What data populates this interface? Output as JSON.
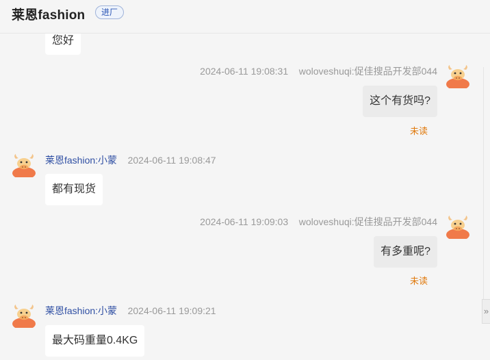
{
  "header": {
    "shop_name": "莱恩fashion",
    "tag": "进厂"
  },
  "messages": [
    {
      "text": "您好"
    },
    {
      "time": "2024-06-11 19:08:31",
      "sender": "woloveshuqi:促佳搜品开发部044",
      "text": "这个有货吗?",
      "status": "未读"
    },
    {
      "time": "2024-06-11 19:08:47",
      "sender": "莱恩fashion:小蒙",
      "text": "都有现货"
    },
    {
      "time": "2024-06-11 19:09:03",
      "sender": "woloveshuqi:促佳搜品开发部044",
      "text": "有多重呢?",
      "status": "未读"
    },
    {
      "time": "2024-06-11 19:09:21",
      "sender": "莱恩fashion:小蒙",
      "text": "最大码重量0.4KG"
    }
  ],
  "icons": {
    "avatar": "cow-avatar-icon",
    "expand": "double-chevron-right-icon"
  },
  "side_tab": {
    "glyph": "»"
  },
  "colors": {
    "unread": "#e07a0e",
    "seller_name": "#2f4fa3",
    "tag_text": "#2a55b5"
  }
}
